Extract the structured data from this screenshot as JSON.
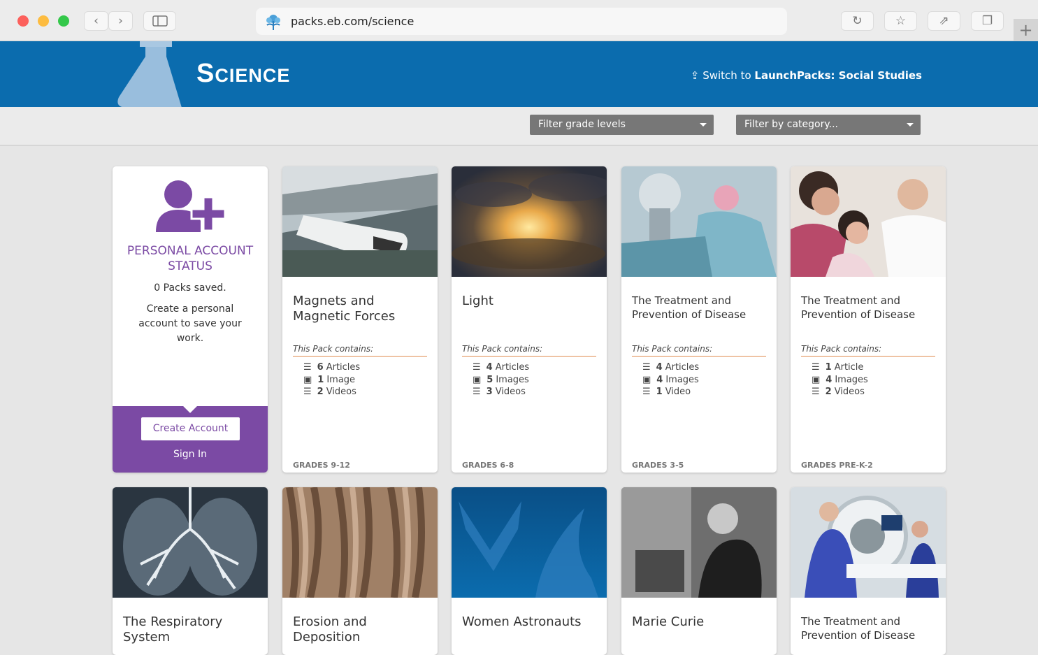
{
  "browser": {
    "url": "packs.eb.com/science"
  },
  "header": {
    "title": "Science",
    "switch_prefix": "Switch to ",
    "switch_target": "LaunchPacks: Social Studies"
  },
  "filters": {
    "grade": "Filter grade levels",
    "category": "Filter by category..."
  },
  "account": {
    "title": "PERSONAL ACCOUNT STATUS",
    "saved": "0 Packs saved.",
    "prompt": "Create a personal account to save your work.",
    "create": "Create Account",
    "signin": "Sign In"
  },
  "contains_label": "This Pack contains:",
  "cards": [
    {
      "title": "Magnets and Magnetic Forces",
      "grade": "GRADES 9-12",
      "items": [
        {
          "n": "6",
          "label": "Articles",
          "icon": "list-icon"
        },
        {
          "n": "1",
          "label": "Image",
          "icon": "image-icon"
        },
        {
          "n": "2",
          "label": "Videos",
          "icon": "list-icon"
        }
      ]
    },
    {
      "title": "Light",
      "grade": "GRADES 6-8",
      "items": [
        {
          "n": "4",
          "label": "Articles",
          "icon": "list-icon"
        },
        {
          "n": "5",
          "label": "Images",
          "icon": "image-icon"
        },
        {
          "n": "3",
          "label": "Videos",
          "icon": "list-icon"
        }
      ]
    },
    {
      "title": "The Treatment and Prevention of Disease",
      "grade": "GRADES 3-5",
      "items": [
        {
          "n": "4",
          "label": "Articles",
          "icon": "list-icon"
        },
        {
          "n": "4",
          "label": "Images",
          "icon": "image-icon"
        },
        {
          "n": "1",
          "label": "Video",
          "icon": "list-icon"
        }
      ]
    },
    {
      "title": "The Treatment and Prevention of Disease",
      "grade": "GRADES PRE-K-2",
      "items": [
        {
          "n": "1",
          "label": "Article",
          "icon": "list-icon"
        },
        {
          "n": "4",
          "label": "Images",
          "icon": "image-icon"
        },
        {
          "n": "2",
          "label": "Videos",
          "icon": "list-icon"
        }
      ]
    }
  ],
  "row2": [
    {
      "title": "The Respiratory System"
    },
    {
      "title": "Erosion and Deposition"
    },
    {
      "title": "Women Astronauts"
    },
    {
      "title": "Marie Curie"
    },
    {
      "title": "The Treatment and Prevention of Disease"
    }
  ]
}
